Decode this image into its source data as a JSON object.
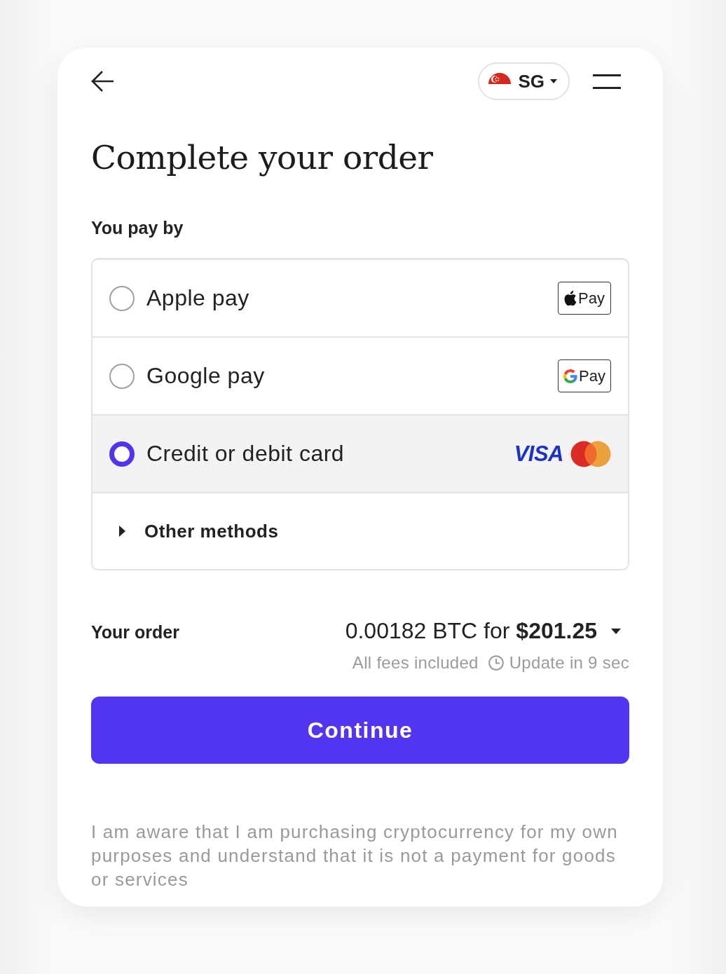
{
  "header": {
    "country": {
      "code": "SG"
    }
  },
  "title": "Complete your order",
  "payment": {
    "label": "You pay by",
    "methods": [
      {
        "kind": "applepay",
        "label": "Apple pay",
        "selected": false,
        "badge_text": "Pay"
      },
      {
        "kind": "googlepay",
        "label": "Google pay",
        "selected": false,
        "badge_text": "Pay"
      },
      {
        "kind": "card",
        "label": "Credit or debit card",
        "selected": true,
        "logo_text": "VISA"
      }
    ],
    "more": {
      "label": "Other methods",
      "expanded": false
    }
  },
  "order": {
    "label": "Your order",
    "amount": "0.00182 BTC for **$201.25**",
    "fees": "All fees included",
    "update": "Update in 9 sec"
  },
  "continue_button": "Continue",
  "disclaimer": "I am aware that I am purchasing cryptocurrency for my own purposes and understand that it is not a payment for goods or services"
}
